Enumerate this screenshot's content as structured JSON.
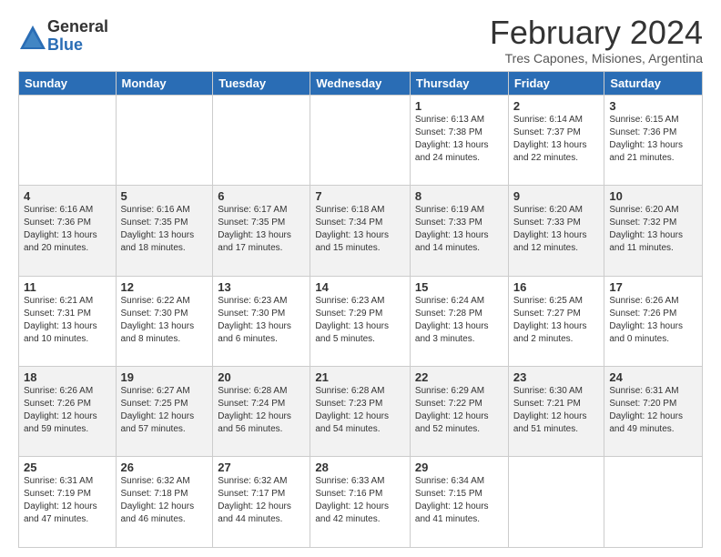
{
  "logo": {
    "general": "General",
    "blue": "Blue"
  },
  "header": {
    "month_year": "February 2024",
    "location": "Tres Capones, Misiones, Argentina"
  },
  "days_of_week": [
    "Sunday",
    "Monday",
    "Tuesday",
    "Wednesday",
    "Thursday",
    "Friday",
    "Saturday"
  ],
  "weeks": [
    [
      {
        "day": "",
        "info": ""
      },
      {
        "day": "",
        "info": ""
      },
      {
        "day": "",
        "info": ""
      },
      {
        "day": "",
        "info": ""
      },
      {
        "day": "1",
        "info": "Sunrise: 6:13 AM\nSunset: 7:38 PM\nDaylight: 13 hours\nand 24 minutes."
      },
      {
        "day": "2",
        "info": "Sunrise: 6:14 AM\nSunset: 7:37 PM\nDaylight: 13 hours\nand 22 minutes."
      },
      {
        "day": "3",
        "info": "Sunrise: 6:15 AM\nSunset: 7:36 PM\nDaylight: 13 hours\nand 21 minutes."
      }
    ],
    [
      {
        "day": "4",
        "info": "Sunrise: 6:16 AM\nSunset: 7:36 PM\nDaylight: 13 hours\nand 20 minutes."
      },
      {
        "day": "5",
        "info": "Sunrise: 6:16 AM\nSunset: 7:35 PM\nDaylight: 13 hours\nand 18 minutes."
      },
      {
        "day": "6",
        "info": "Sunrise: 6:17 AM\nSunset: 7:35 PM\nDaylight: 13 hours\nand 17 minutes."
      },
      {
        "day": "7",
        "info": "Sunrise: 6:18 AM\nSunset: 7:34 PM\nDaylight: 13 hours\nand 15 minutes."
      },
      {
        "day": "8",
        "info": "Sunrise: 6:19 AM\nSunset: 7:33 PM\nDaylight: 13 hours\nand 14 minutes."
      },
      {
        "day": "9",
        "info": "Sunrise: 6:20 AM\nSunset: 7:33 PM\nDaylight: 13 hours\nand 12 minutes."
      },
      {
        "day": "10",
        "info": "Sunrise: 6:20 AM\nSunset: 7:32 PM\nDaylight: 13 hours\nand 11 minutes."
      }
    ],
    [
      {
        "day": "11",
        "info": "Sunrise: 6:21 AM\nSunset: 7:31 PM\nDaylight: 13 hours\nand 10 minutes."
      },
      {
        "day": "12",
        "info": "Sunrise: 6:22 AM\nSunset: 7:30 PM\nDaylight: 13 hours\nand 8 minutes."
      },
      {
        "day": "13",
        "info": "Sunrise: 6:23 AM\nSunset: 7:30 PM\nDaylight: 13 hours\nand 6 minutes."
      },
      {
        "day": "14",
        "info": "Sunrise: 6:23 AM\nSunset: 7:29 PM\nDaylight: 13 hours\nand 5 minutes."
      },
      {
        "day": "15",
        "info": "Sunrise: 6:24 AM\nSunset: 7:28 PM\nDaylight: 13 hours\nand 3 minutes."
      },
      {
        "day": "16",
        "info": "Sunrise: 6:25 AM\nSunset: 7:27 PM\nDaylight: 13 hours\nand 2 minutes."
      },
      {
        "day": "17",
        "info": "Sunrise: 6:26 AM\nSunset: 7:26 PM\nDaylight: 13 hours\nand 0 minutes."
      }
    ],
    [
      {
        "day": "18",
        "info": "Sunrise: 6:26 AM\nSunset: 7:26 PM\nDaylight: 12 hours\nand 59 minutes."
      },
      {
        "day": "19",
        "info": "Sunrise: 6:27 AM\nSunset: 7:25 PM\nDaylight: 12 hours\nand 57 minutes."
      },
      {
        "day": "20",
        "info": "Sunrise: 6:28 AM\nSunset: 7:24 PM\nDaylight: 12 hours\nand 56 minutes."
      },
      {
        "day": "21",
        "info": "Sunrise: 6:28 AM\nSunset: 7:23 PM\nDaylight: 12 hours\nand 54 minutes."
      },
      {
        "day": "22",
        "info": "Sunrise: 6:29 AM\nSunset: 7:22 PM\nDaylight: 12 hours\nand 52 minutes."
      },
      {
        "day": "23",
        "info": "Sunrise: 6:30 AM\nSunset: 7:21 PM\nDaylight: 12 hours\nand 51 minutes."
      },
      {
        "day": "24",
        "info": "Sunrise: 6:31 AM\nSunset: 7:20 PM\nDaylight: 12 hours\nand 49 minutes."
      }
    ],
    [
      {
        "day": "25",
        "info": "Sunrise: 6:31 AM\nSunset: 7:19 PM\nDaylight: 12 hours\nand 47 minutes."
      },
      {
        "day": "26",
        "info": "Sunrise: 6:32 AM\nSunset: 7:18 PM\nDaylight: 12 hours\nand 46 minutes."
      },
      {
        "day": "27",
        "info": "Sunrise: 6:32 AM\nSunset: 7:17 PM\nDaylight: 12 hours\nand 44 minutes."
      },
      {
        "day": "28",
        "info": "Sunrise: 6:33 AM\nSunset: 7:16 PM\nDaylight: 12 hours\nand 42 minutes."
      },
      {
        "day": "29",
        "info": "Sunrise: 6:34 AM\nSunset: 7:15 PM\nDaylight: 12 hours\nand 41 minutes."
      },
      {
        "day": "",
        "info": ""
      },
      {
        "day": "",
        "info": ""
      }
    ]
  ]
}
